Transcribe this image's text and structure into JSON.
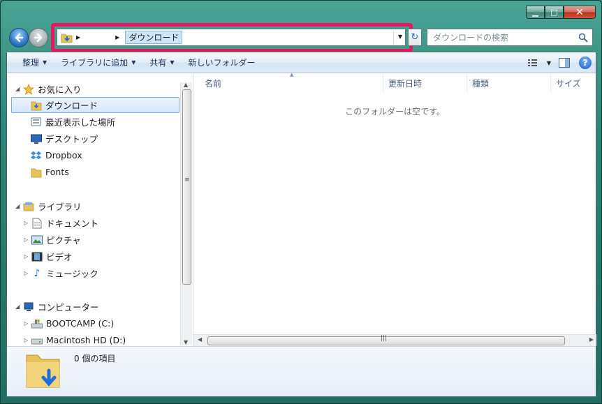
{
  "window": {
    "captions": {
      "minimize": "▁",
      "maximize": "□",
      "close": "✕"
    }
  },
  "address": {
    "segment": "ダウンロード"
  },
  "search": {
    "placeholder": "ダウンロードの検索"
  },
  "toolbar": {
    "organize": "整理",
    "add_to_library": "ライブラリに追加",
    "share": "共有",
    "new_folder": "新しいフォルダー"
  },
  "navpane": {
    "favorites": {
      "label": "お気に入り",
      "items": [
        "ダウンロード",
        "最近表示した場所",
        "デスクトップ",
        "Dropbox",
        "Fonts"
      ]
    },
    "libraries": {
      "label": "ライブラリ",
      "items": [
        "ドキュメント",
        "ピクチャ",
        "ビデオ",
        "ミュージック"
      ]
    },
    "computer": {
      "label": "コンピューター",
      "items": [
        "BOOTCAMP (C:)",
        "Macintosh HD (D:)"
      ]
    }
  },
  "content": {
    "columns": [
      "名前",
      "更新日時",
      "種類",
      "サイズ"
    ],
    "empty_message": "このフォルダーは空です。"
  },
  "details": {
    "item_count": "0 個の項目"
  },
  "colors": {
    "highlight": "#e8175f",
    "frame": "#2c8274",
    "selection": "#d5e7fb"
  }
}
